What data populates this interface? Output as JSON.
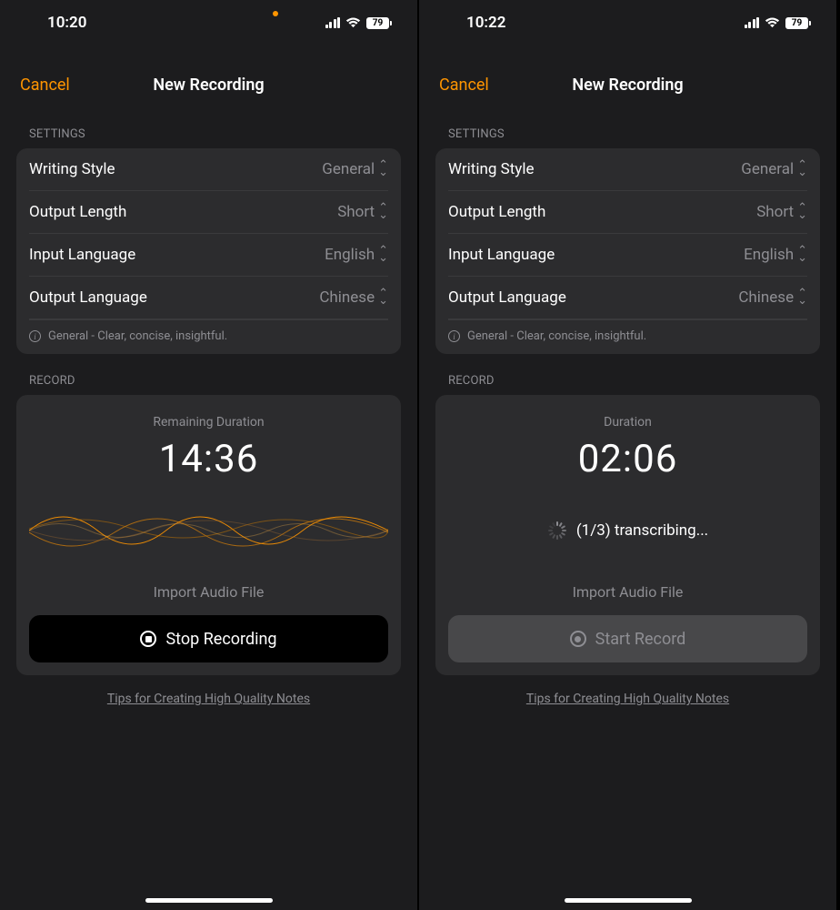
{
  "screens": [
    {
      "status": {
        "time": "10:20",
        "battery": "79",
        "has_privacy_dot": true
      },
      "nav": {
        "cancel": "Cancel",
        "title": "New Recording"
      },
      "settings": {
        "label": "SETTINGS",
        "rows": [
          {
            "label": "Writing Style",
            "value": "General"
          },
          {
            "label": "Output Length",
            "value": "Short"
          },
          {
            "label": "Input Language",
            "value": "English"
          },
          {
            "label": "Output Language",
            "value": "Chinese"
          }
        ],
        "info": "General - Clear, concise, insightful."
      },
      "record": {
        "label": "RECORD",
        "duration_label": "Remaining Duration",
        "duration": "14:36",
        "visual": "waveform",
        "import_label": "Import Audio File",
        "button": {
          "label": "Stop Recording",
          "style": "black",
          "icon": "stop"
        },
        "tips": "Tips for Creating High Quality Notes"
      }
    },
    {
      "status": {
        "time": "10:22",
        "battery": "79",
        "has_privacy_dot": false
      },
      "nav": {
        "cancel": "Cancel",
        "title": "New Recording"
      },
      "settings": {
        "label": "SETTINGS",
        "rows": [
          {
            "label": "Writing Style",
            "value": "General"
          },
          {
            "label": "Output Length",
            "value": "Short"
          },
          {
            "label": "Input Language",
            "value": "English"
          },
          {
            "label": "Output Language",
            "value": "Chinese"
          }
        ],
        "info": "General - Clear, concise, insightful."
      },
      "record": {
        "label": "RECORD",
        "duration_label": "Duration",
        "duration": "02:06",
        "visual": "status",
        "status_text": "(1/3) transcribing...",
        "import_label": "Import Audio File",
        "button": {
          "label": "Start Record",
          "style": "gray",
          "icon": "record"
        },
        "tips": "Tips for Creating High Quality Notes"
      }
    }
  ]
}
